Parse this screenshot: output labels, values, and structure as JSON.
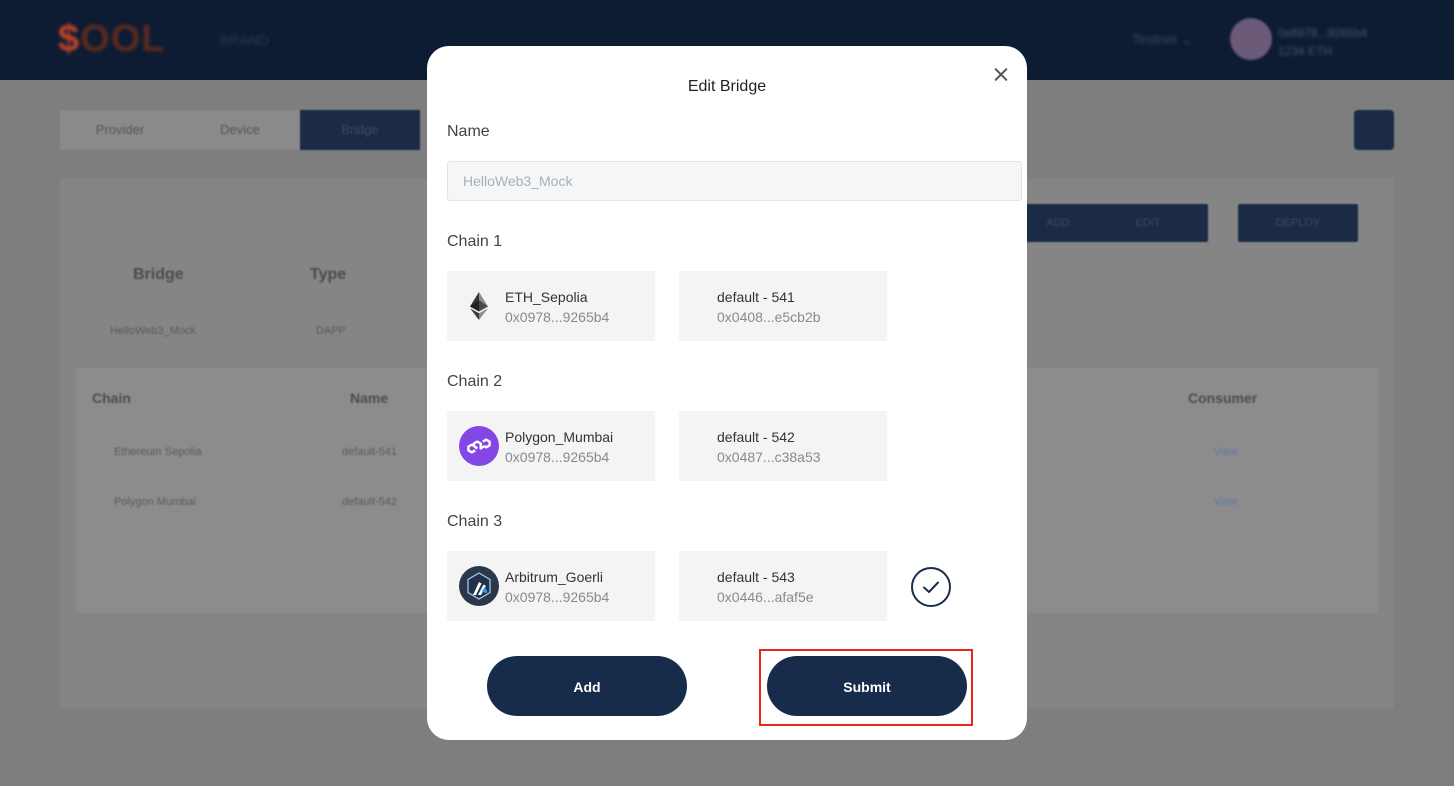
{
  "background": {
    "logo_text": "OOL",
    "logo_sub": "BRAND",
    "network": "Testnet",
    "user_line1": "0x8978...9265b4",
    "user_line2": "1234 ETH",
    "tabs": [
      "Provider",
      "Device",
      "Bridge"
    ],
    "buttons": [
      "ADD",
      "EDIT",
      "DEPLOY"
    ],
    "table_headers": [
      "Bridge",
      "Type"
    ],
    "row": {
      "bridge": "HelloWeb3_Mock",
      "type": "DAPP"
    },
    "sub_headers": [
      "Chain",
      "Name",
      "Consumer"
    ],
    "sub_rows": [
      {
        "chain": "Ethereum Sepolia",
        "name": "default-541",
        "consumer": "View"
      },
      {
        "chain": "Polygon Mumbai",
        "name": "default-542",
        "consumer": "View"
      }
    ]
  },
  "modal": {
    "title": "Edit Bridge",
    "name_label": "Name",
    "name_placeholder": "HelloWeb3_Mock",
    "chains": [
      {
        "label": "Chain 1",
        "network": "ETH_Sepolia",
        "network_addr": "0x0978...9265b4",
        "icon": "ethereum-icon",
        "function": "default - 541",
        "function_addr": "0x0408...e5cb2b"
      },
      {
        "label": "Chain 2",
        "network": "Polygon_Mumbai",
        "network_addr": "0x0978...9265b4",
        "icon": "polygon-icon",
        "function": "default - 542",
        "function_addr": "0x0487...c38a53"
      },
      {
        "label": "Chain 3",
        "network": "Arbitrum_Goerli",
        "network_addr": "0x0978...9265b4",
        "icon": "arbitrum-icon",
        "function": "default - 543",
        "function_addr": "0x0446...afaf5e"
      }
    ],
    "add_label": "Add",
    "submit_label": "Submit"
  },
  "colors": {
    "primary": "#172b4a",
    "polygon": "#8247e5",
    "arbitrum": "#2d374b",
    "highlight": "#e8281c"
  }
}
